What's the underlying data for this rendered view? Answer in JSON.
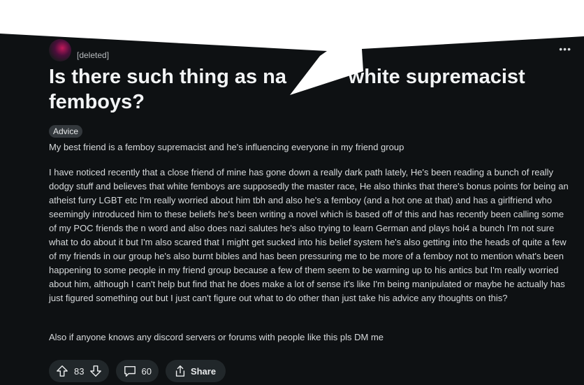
{
  "post": {
    "author": "[deleted]",
    "title": "Is there such thing as na           white supremacist femboys?",
    "flair": "Advice",
    "body": [
      "My best friend is a femboy supremacist and he's influencing everyone in my friend group",
      "I have noticed recently that a close friend of mine has gone down a really dark path lately, He's been reading a bunch of really dodgy stuff and believes that white femboys are supposedly the master race, He also thinks that there's bonus points for being an atheist furry LGBT etc I'm really worried about him tbh and also he's a femboy (and a hot one at that) and has a girlfriend who seemingly introduced him to these beliefs he's been writing a novel which is based off of this and has recently been calling some of my POC friends the n word and also does nazi salutes he's also trying to learn German and plays hoi4 a bunch I'm not sure what to do about it but I'm also scared that I might get sucked into his belief system he's also getting into the heads of quite a few of my friends in our group he's also burnt bibles and has been pressuring me to be more of a femboy not to mention what's been happening to some people in my friend group because a few of them seem to be warming up to his antics but I'm really worried about him, although I can't help but find that he does make a lot of sense it's like I'm being manipulated or maybe he actually has just figured something out but I just can't figure out what to do other than just take his advice any thoughts on this?",
      "Also if anyone knows any discord servers or forums with people like this pls DM me"
    ]
  },
  "actions": {
    "votes": "83",
    "comments": "60",
    "share_label": "Share"
  },
  "menu": {
    "more_label": "•••"
  },
  "icons": {
    "upvote": "upvote-arrow-icon",
    "downvote": "downvote-arrow-icon",
    "comment": "comment-bubble-icon",
    "share": "share-icon"
  },
  "colors": {
    "background": "#0e1113",
    "text": "#d7dadc",
    "pill": "#21272a",
    "flair": "#33383c"
  }
}
